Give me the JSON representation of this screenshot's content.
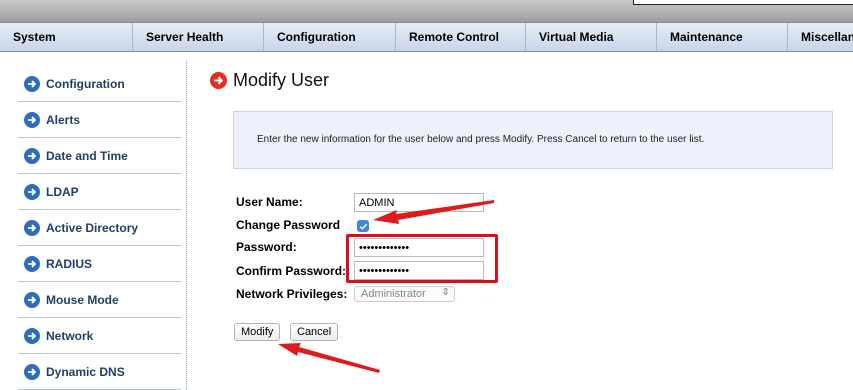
{
  "menu": [
    "System",
    "Server Health",
    "Configuration",
    "Remote Control",
    "Virtual Media",
    "Maintenance",
    "Miscellan"
  ],
  "sidebar": [
    "Configuration",
    "Alerts",
    "Date and Time",
    "LDAP",
    "Active Directory",
    "RADIUS",
    "Mouse Mode",
    "Network",
    "Dynamic DNS"
  ],
  "page": {
    "title": "Modify User",
    "info": "Enter the new information for the user below and press Modify. Press Cancel to return to the user list."
  },
  "form": {
    "user_name_label": "User Name:",
    "user_name_value": "ADMIN",
    "change_password_label": "Change Password",
    "password_label": "Password:",
    "password_value": "•••••••••••••",
    "confirm_label": "Confirm Password:",
    "confirm_value": "•••••••••••••",
    "privileges_label": "Network Privileges:",
    "privileges_value": "Administrator"
  },
  "buttons": {
    "modify": "Modify",
    "cancel": "Cancel"
  },
  "colors": {
    "accent_red": "#d8101a",
    "nav_blue": "#2e6cc0"
  }
}
